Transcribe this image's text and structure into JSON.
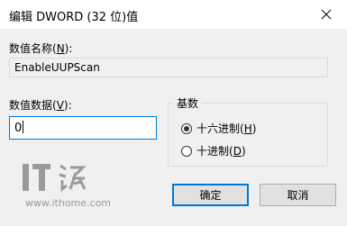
{
  "window": {
    "title": "编辑 DWORD (32 位)值",
    "close_icon": "close-icon"
  },
  "name_section": {
    "label": "数值名称(",
    "mnemonic": "N",
    "label_end": "):",
    "value": "EnableUUPScan"
  },
  "data_section": {
    "label": "数值数据(",
    "mnemonic": "V",
    "label_end": "):",
    "value": "0"
  },
  "base_group": {
    "title": "基数",
    "options": [
      {
        "label": "十六进制(",
        "mnemonic": "H",
        "label_end": ")",
        "checked": true
      },
      {
        "label": "十进制(",
        "mnemonic": "D",
        "label_end": ")",
        "checked": false
      }
    ]
  },
  "buttons": {
    "ok": "确定",
    "cancel": "取消"
  },
  "watermark": {
    "logo_text": "IT",
    "url": "www.ithome.com",
    "color": "#9a9a9a"
  },
  "colors": {
    "focus_accent": "#0078d7",
    "dialog_bg": "#f0f0f0"
  }
}
